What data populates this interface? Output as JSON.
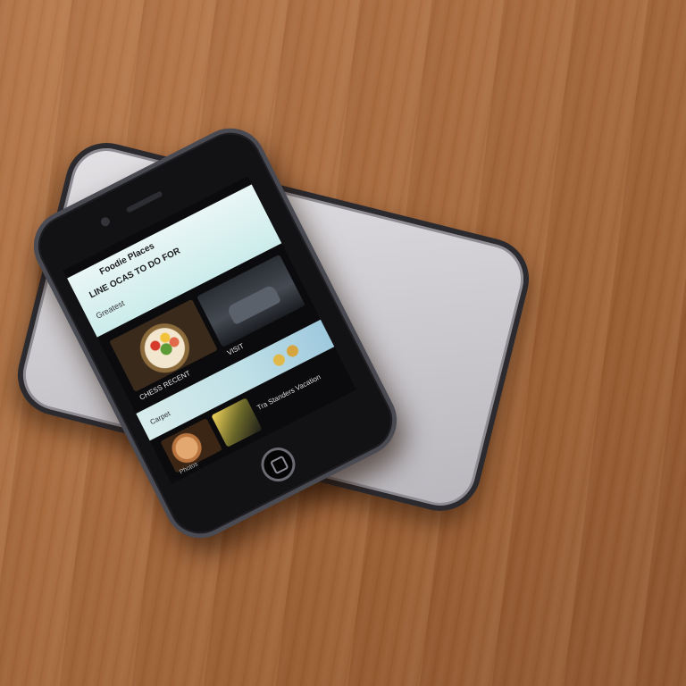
{
  "scene": {
    "surface": "wood-table",
    "colors": {
      "wood": "#a86b3e",
      "back_phone_silver": "#cfcdd1",
      "front_phone_bezel": "#121214",
      "screen_banner": "#cbeceb"
    }
  },
  "screen": {
    "banner_title": "Foodie Places",
    "banner_subtitle": "LINE OCAS TO DO FOR",
    "banner_note": "Greatest",
    "food_caption": "CHESS RECENT",
    "car_caption": "VISIT",
    "strip_caption": "Carpet",
    "bottom_caption": "Tra Standers Vacation",
    "footer_caption": "Photos"
  }
}
